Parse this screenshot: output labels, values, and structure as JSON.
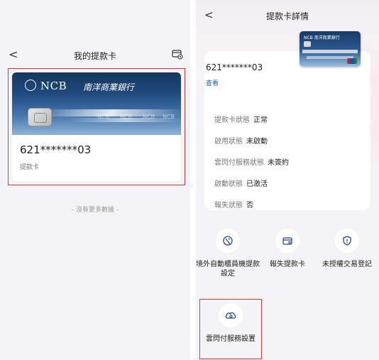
{
  "left": {
    "header": {
      "back_label": "<",
      "title": "我的提款卡"
    },
    "card": {
      "brand": "NCB",
      "brand_cn": "南洋商業銀行",
      "watermark": "NCB",
      "number": "621*******03",
      "type": "提款卡"
    },
    "footer": {
      "no_more": "- 沒有更多數據 -"
    }
  },
  "right": {
    "header": {
      "back_label": "<",
      "title": "提款卡詳情"
    },
    "card": {
      "number": "621*******03",
      "view_label": "查看",
      "mini_brand": "NCB 南洋商業銀行"
    },
    "rows": [
      {
        "label": "提款卡狀態",
        "value": "正常"
      },
      {
        "label": "啟用狀態",
        "value": "未啟動"
      },
      {
        "label": "雲閃付服務狀態",
        "value": "未簽約"
      },
      {
        "label": "啟動狀態",
        "value": "已激活"
      },
      {
        "label": "報失狀態",
        "value": "否"
      }
    ],
    "actions": [
      {
        "label": "境外自動櫃員機提款設定",
        "icon": "atm-globe-icon"
      },
      {
        "label": "報失提款卡",
        "icon": "card-icon"
      },
      {
        "label": "未授權交易登記",
        "icon": "shield-alert-icon"
      }
    ],
    "cloud_pay": {
      "label": "雲閃付服務設置",
      "icon": "cloud-pay-icon"
    }
  },
  "colors": {
    "highlight": "#e5323b",
    "link": "#2b5fb0",
    "accent": "#2b4a8a",
    "card_blue": "#1f4b80"
  }
}
